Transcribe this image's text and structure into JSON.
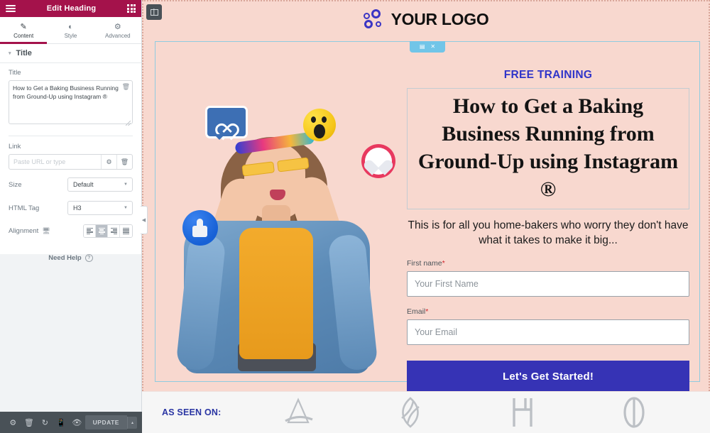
{
  "editor": {
    "header": {
      "title": "Edit Heading",
      "menu_icon": "hamburger-icon",
      "apps_icon": "grid-apps-icon"
    },
    "tabs": [
      {
        "label": "Content",
        "icon": "pencil-icon",
        "active": true
      },
      {
        "label": "Style",
        "icon": "contrast-circle-icon",
        "active": false
      },
      {
        "label": "Advanced",
        "icon": "gear-icon",
        "active": false
      }
    ],
    "section": {
      "label": "Title",
      "caret": "▾"
    },
    "controls": {
      "title_label": "Title",
      "title_value": "How to Get a Baking Business Running from Ground-Up using Instagram ®",
      "title_delete_icon": "trash-icon",
      "link_label": "Link",
      "link_value": "",
      "link_placeholder": "Paste URL or type",
      "link_settings_icon": "gear-icon",
      "link_delete_icon": "trash-icon",
      "size_label": "Size",
      "size_value": "Default",
      "html_tag_label": "HTML Tag",
      "html_tag_value": "H3",
      "alignment_label": "Alignment",
      "alignment_device_icon": "monitor-icon",
      "alignment_options": [
        "left",
        "center",
        "right",
        "justify"
      ],
      "alignment_selected": "center"
    },
    "need_help": {
      "label": "Need Help",
      "icon": "question-circle-icon"
    },
    "footer": {
      "icons": [
        "settings-gear-icon",
        "trash-icon",
        "history-revisions-icon",
        "responsive-mode-icon",
        "preview-eye-icon"
      ],
      "update_label": "UPDATE",
      "update_caret": "▴"
    },
    "collapse_handle": {
      "icon": "chevron-left-icon"
    },
    "canvas_overlays": {
      "section_handle_icon": "columns-handle-icon",
      "widget_tab": {
        "columns_icon": "columns-icon",
        "close_icon": "close-x-icon"
      }
    }
  },
  "page": {
    "logo": {
      "text": "YOUR LOGO",
      "mark": "four-rings-logo-icon",
      "mark_color": "#3b35c4"
    },
    "hero": {
      "eyebrow": "FREE TRAINING",
      "eyebrow_color": "#2f34c9",
      "headline": "How to Get a Baking Business Running from Ground-Up using Instagram ®",
      "subheadline": "This is for all you home-bakers who worry they don't have what it takes to make it big...",
      "background_color": "#f8d8cf",
      "image_alt": "woman-with-social-emojis-photo",
      "emojis": [
        "message-heart-icon",
        "wow-face-icon",
        "love-heart-icon",
        "thumbs-up-icon"
      ],
      "form": {
        "first_name_label": "First name",
        "first_name_required": "*",
        "first_name_value": "",
        "first_name_placeholder": "Your First Name",
        "email_label": "Email",
        "email_required": "*",
        "email_value": "",
        "email_placeholder": "Your Email",
        "submit_label": "Let's Get Started!",
        "submit_color": "#3633b5"
      }
    },
    "as_seen_on": {
      "label": "AS SEEN ON:",
      "label_color": "#2a35a3",
      "logos": [
        "brand-logo-a-icon",
        "brand-logo-diamond-icon",
        "brand-logo-h-icon",
        "brand-logo-o-icon"
      ]
    }
  }
}
